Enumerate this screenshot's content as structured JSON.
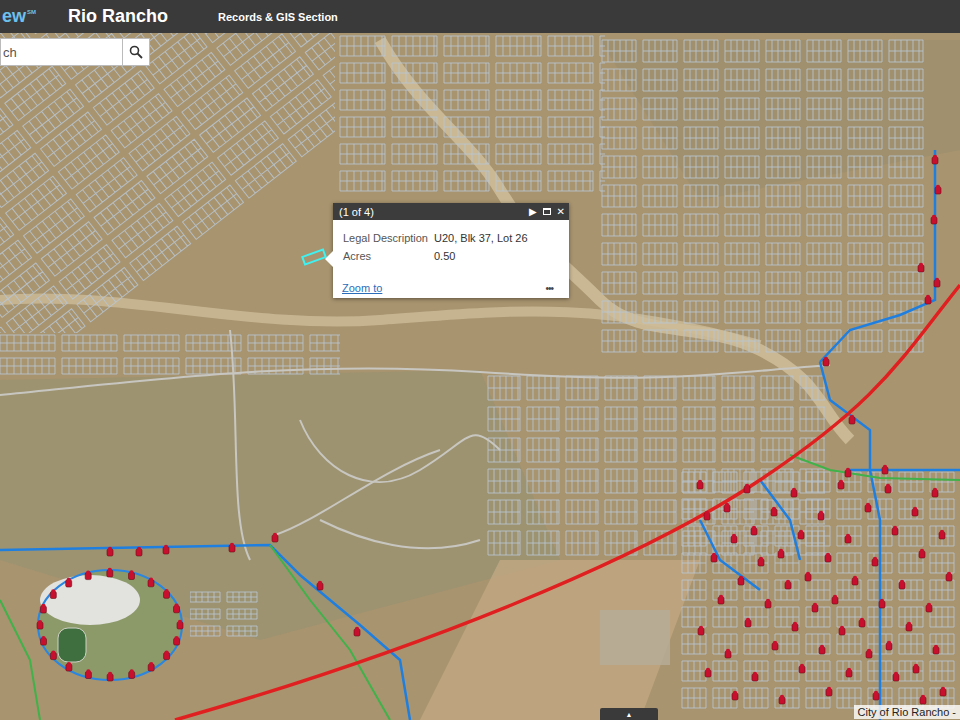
{
  "header": {
    "logo": "ew",
    "logo_mark": "SM",
    "title": "Rio Rancho",
    "section": "Records & GIS Section"
  },
  "search": {
    "placeholder": "ch"
  },
  "popup": {
    "counter": "(1 of 4)",
    "next_icon": "▶",
    "close_icon": "✕",
    "fields": [
      {
        "label": "Legal Description",
        "value": "U20, Blk 37, Lot 26"
      },
      {
        "label": "Acres",
        "value": "0.50"
      }
    ],
    "zoom_link": "Zoom to",
    "more_icon": "•••"
  },
  "attribution": "City of Rio Rancho -",
  "collapse_tab": "▲"
}
